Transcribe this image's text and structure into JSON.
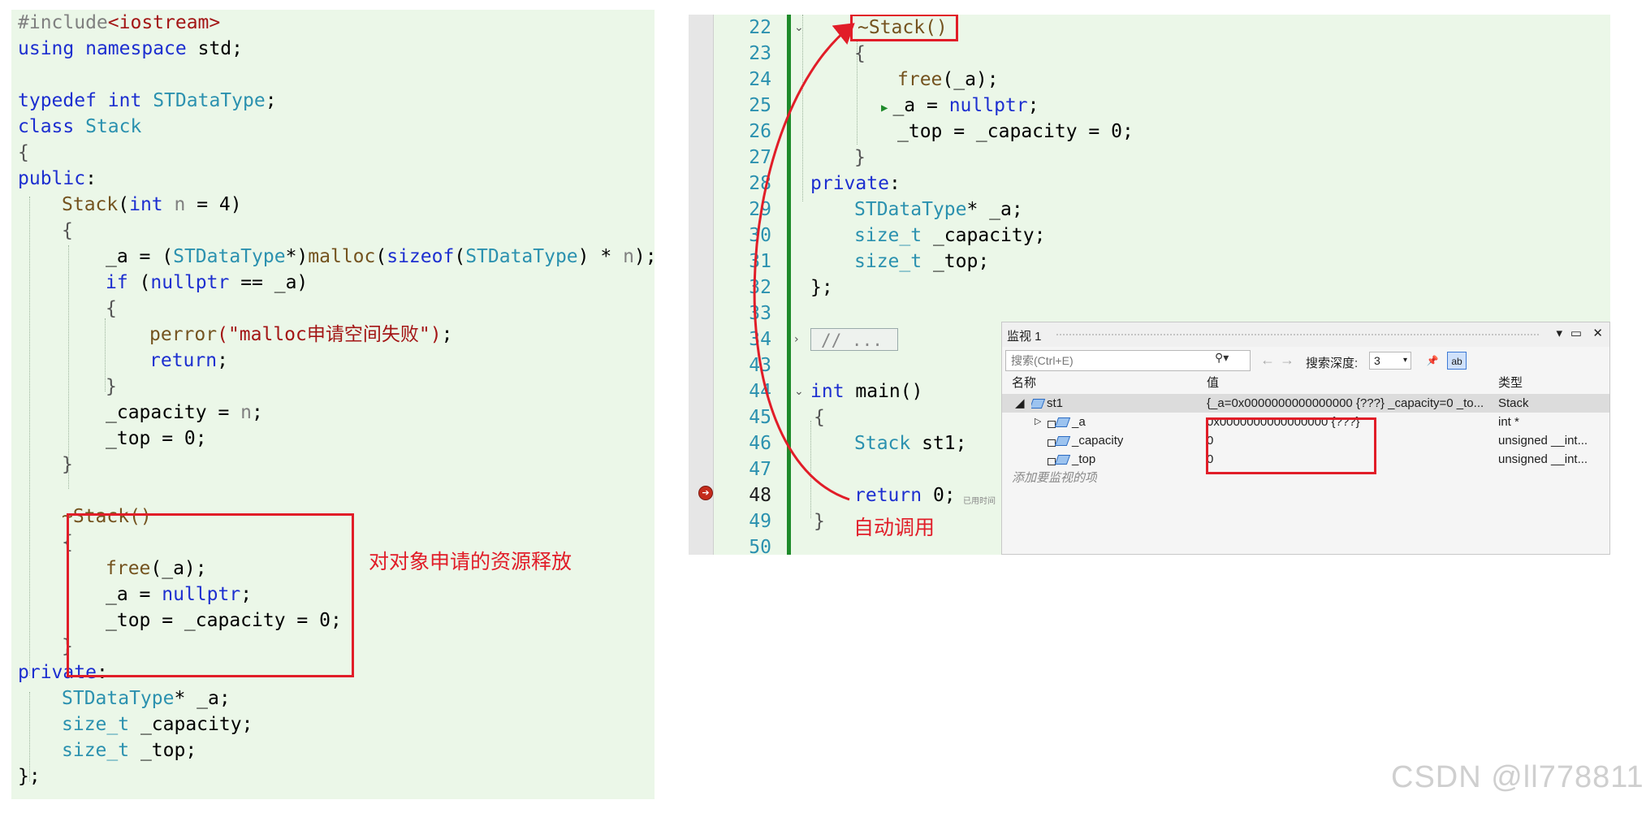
{
  "left_code": {
    "l1_hash": "#include",
    "l1_header": "<iostream>",
    "l2_using": "using",
    "l2_namespace": "namespace",
    "l2_std": "std;",
    "l4_typedef": "typedef",
    "l4_int": "int",
    "l4_type": "STDataType",
    "l4_semi": ";",
    "l5_class": "class",
    "l5_name": "Stack",
    "brace_open": "{",
    "brace_close": "}",
    "l7_public": "public",
    "colon": ":",
    "ctor_name": "Stack",
    "ctor_paren_open": "(",
    "ctor_int": "int",
    "ctor_param": " n",
    "ctor_default": " = 4)",
    "l10_a": "_a = (",
    "l10_type": "STDataType",
    "l10_star": "*)",
    "l10_malloc": "malloc",
    "l10_paren": "(",
    "l10_sizeof": "sizeof",
    "l10_paren2": "(",
    "l10_type2": "STDataType",
    "l10_mul": ") * ",
    "l10_n": "n",
    "l10_end": ");",
    "l11_if": "if",
    "l11_rest1": " (",
    "l11_nullptr": "nullptr",
    "l11_rest2": " == _a)",
    "l13_perror": "perror",
    "l13_str": "(\"malloc申请空间失败\")",
    "l13_end": ";",
    "l14_return": "return",
    "l14_end": ";",
    "l16_cap": "_capacity = ",
    "l16_n": "n",
    "l16_end": ";",
    "l17_top": "_top = 0;",
    "dtor_name": "~Stack()",
    "dtor_free": "free",
    "dtor_free_arg": "(_a);",
    "dtor_a": "_a = ",
    "dtor_nullptr": "nullptr",
    "dtor_a_end": ";",
    "dtor_top": "_top = _capacity = 0;",
    "private": "private",
    "mem1_type": "STDataType",
    "mem1_rest": "* _a;",
    "mem2_type": "size_t",
    "mem2_rest": " _capacity;",
    "mem3_type": "size_t",
    "mem3_rest": " _top;",
    "class_end": "};",
    "annotation": "对对象申请的资源释放"
  },
  "right_editor": {
    "line_numbers": [
      "22",
      "23",
      "24",
      "25",
      "26",
      "27",
      "28",
      "29",
      "30",
      "31",
      "32",
      "33",
      "34",
      "43",
      "44",
      "45",
      "46",
      "47",
      "48",
      "49",
      "50"
    ],
    "dtor_name": "~Stack()",
    "brace_open": "{",
    "brace_close": "}",
    "free": "free",
    "free_arg": "(_a);",
    "a_assign": "_a = ",
    "nullptr": "nullptr",
    "semi": ";",
    "top_assign": "_top = _capacity = 0;",
    "private": "private",
    "colon": ":",
    "mem1_type": "STDataType",
    "mem1_rest": "* _a;",
    "mem2_type": "size_t",
    "mem2_rest": " _capacity;",
    "mem3_type": "size_t",
    "mem3_rest": " _top;",
    "class_end": "};",
    "collapsed": "// ...",
    "main_int": "int",
    "main_name": " main()",
    "stack_type": "Stack",
    "stack_var": " st1;",
    "return_kw": "return",
    "return_rest": " 0;",
    "elapsed": "已用时间",
    "annotation": "自动调用"
  },
  "watch": {
    "title": "监视 1",
    "search_placeholder": "搜索(Ctrl+E)",
    "depth_label": "搜索深度:",
    "depth_value": "3",
    "col_name": "名称",
    "col_value": "值",
    "col_type": "类型",
    "rows": [
      {
        "name": "st1",
        "value": "{_a=0x0000000000000000 {???} _capacity=0 _to...",
        "type": "Stack"
      },
      {
        "name": "_a",
        "value": "0x0000000000000000 {???}",
        "type": "int *"
      },
      {
        "name": "_capacity",
        "value": "0",
        "type": "unsigned __int..."
      },
      {
        "name": "_top",
        "value": "0",
        "type": "unsigned __int..."
      }
    ],
    "add_item": "添加要监视的项"
  },
  "watermark": "CSDN @ll778811",
  "colors": {
    "annotation_red": "#e11d28",
    "editor_bg": "#ebf7e8",
    "keyword_blue": "#1d2fd0",
    "type_teal": "#2b91af"
  }
}
